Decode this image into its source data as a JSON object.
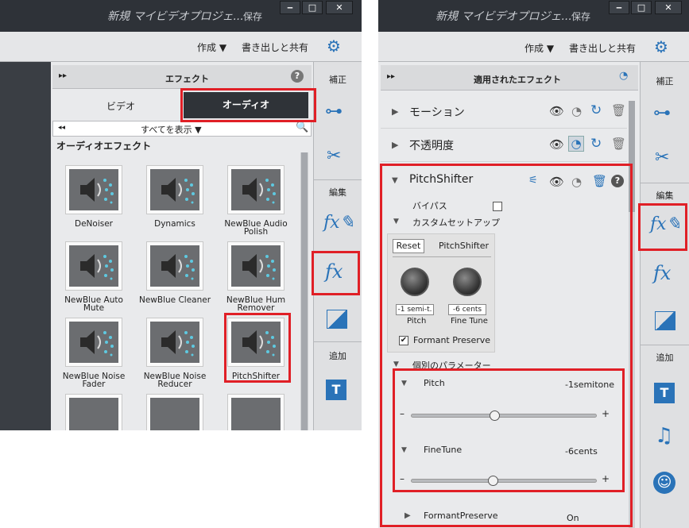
{
  "left": {
    "title": "新規 マイビデオプロジェ...",
    "save": "保存",
    "menu": {
      "create": "作成 ▼",
      "export": "書き出しと共有"
    },
    "panel_title": "エフェクト",
    "help_icon": "?",
    "tabs": {
      "video": "ビデオ",
      "audio": "オーディオ"
    },
    "filter": {
      "back": "◂◂",
      "show_all": "すべてを表示 ▼"
    },
    "section": "オーディオエフェクト",
    "effects": [
      {
        "label1": "DeNoiser",
        "label2": ""
      },
      {
        "label1": "Dynamics",
        "label2": ""
      },
      {
        "label1": "NewBlue Audio",
        "label2": "Polish"
      },
      {
        "label1": "NewBlue Auto Mute",
        "label2": ""
      },
      {
        "label1": "NewBlue Cleaner",
        "label2": ""
      },
      {
        "label1": "NewBlue Hum",
        "label2": "Remover"
      },
      {
        "label1": "NewBlue Noise",
        "label2": "Fader"
      },
      {
        "label1": "NewBlue Noise",
        "label2": "Reducer"
      },
      {
        "label1": "PitchShifter",
        "label2": ""
      }
    ],
    "rail": {
      "correct": "補正",
      "edit": "編集",
      "add": "追加"
    }
  },
  "right": {
    "title": "新規 マイビデオプロジェ...",
    "save": "保存",
    "menu": {
      "create": "作成 ▼",
      "export": "書き出しと共有"
    },
    "panel_title": "適用されたエフェクト",
    "effects": [
      {
        "label": "モーション"
      },
      {
        "label": "不透明度"
      }
    ],
    "pitch": {
      "label": "PitchShifter",
      "bypass": "バイパス",
      "custom_setup": "カスタムセットアップ",
      "reset": "Reset",
      "plugin_name": "PitchShifter",
      "knob1_value": "-1 semi-t.",
      "knob1_label": "Pitch",
      "knob2_value": "-6 cents",
      "knob2_label": "Fine Tune",
      "formant_check": "Formant Preserve",
      "params_title": "個別のパラメーター",
      "params": [
        {
          "name": "Pitch",
          "value": "-1semitone",
          "level": 0.45
        },
        {
          "name": "FineTune",
          "value": "-6cents",
          "level": 0.44
        }
      ],
      "formant_param": {
        "name": "FormantPreserve",
        "value": "On"
      }
    },
    "rail": {
      "correct": "補正",
      "edit": "編集",
      "add": "追加"
    }
  },
  "common": {
    "minus": "–",
    "plus": "+"
  },
  "colors": {
    "highlight": "#e01f26",
    "accent": "#2a73b8",
    "titlebar": "#2e3238"
  }
}
